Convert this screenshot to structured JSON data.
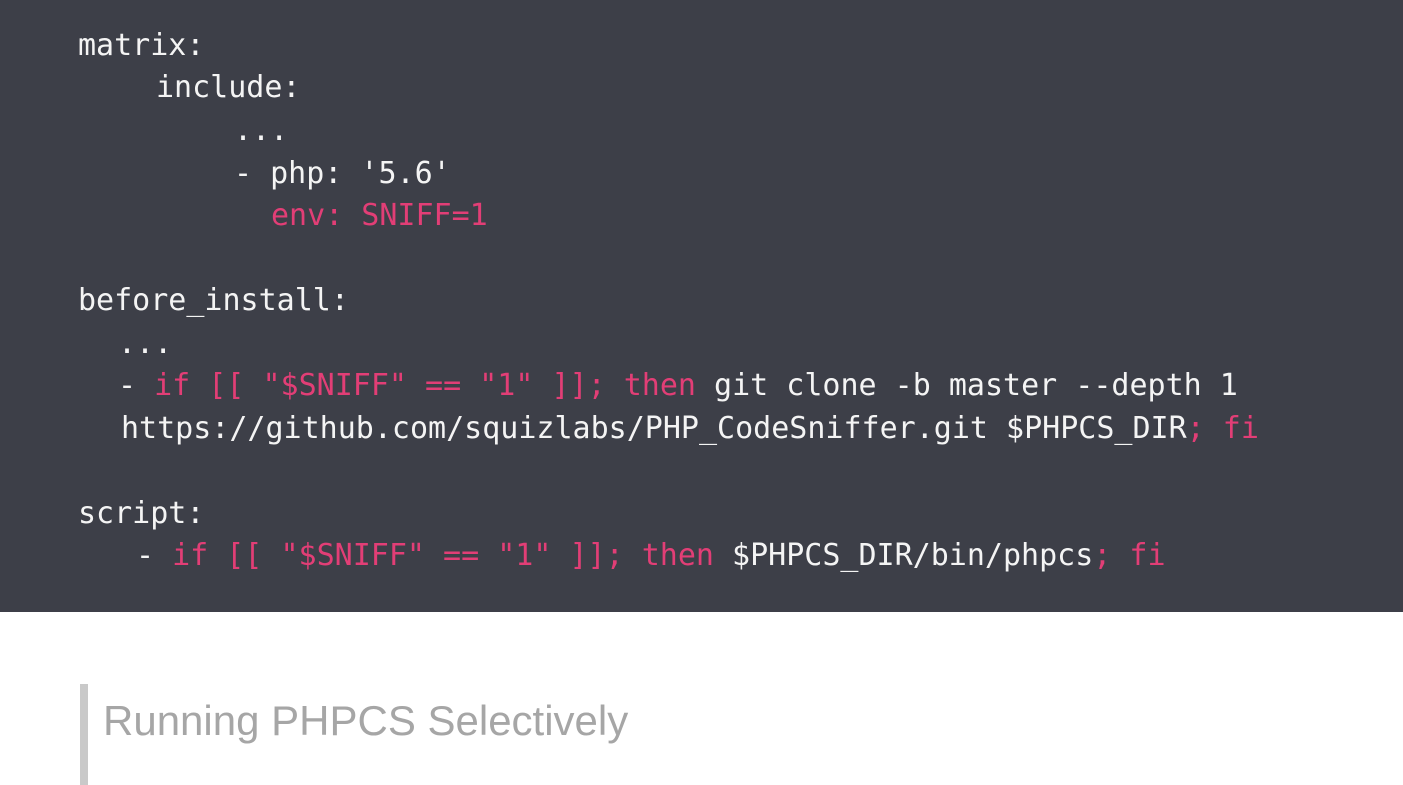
{
  "colors": {
    "code_background": "#3d3f48",
    "code_text": "#f4f4f4",
    "code_highlight": "#e23e76",
    "title_text": "#a6a6a6",
    "title_accent_bar": "#c9c9c9"
  },
  "code": {
    "matrix_key": "matrix:",
    "include_key": "include:",
    "ellipsis_1": "...",
    "php_version": "- php: '5.6'",
    "env_sniff": "env: SNIFF=1",
    "before_install_key": "before_install:",
    "ellipsis_2": "...",
    "before_install_line": {
      "dash": "- ",
      "condition": "if [[ \"$SNIFF\" == \"1\" ]]; then",
      "command": " git clone -b master --depth 1"
    },
    "before_install_line2": {
      "command": "https://github.com/squizlabs/PHP_CodeSniffer.git $PHPCS_DIR",
      "end": "; fi"
    },
    "script_key": "script:",
    "script_line": {
      "dash": "- ",
      "condition": "if [[ \"$SNIFF\" == \"1\" ]]; then",
      "command": " $PHPCS_DIR/bin/phpcs",
      "end": "; fi"
    }
  },
  "slide": {
    "title": "Running PHPCS Selectively"
  }
}
